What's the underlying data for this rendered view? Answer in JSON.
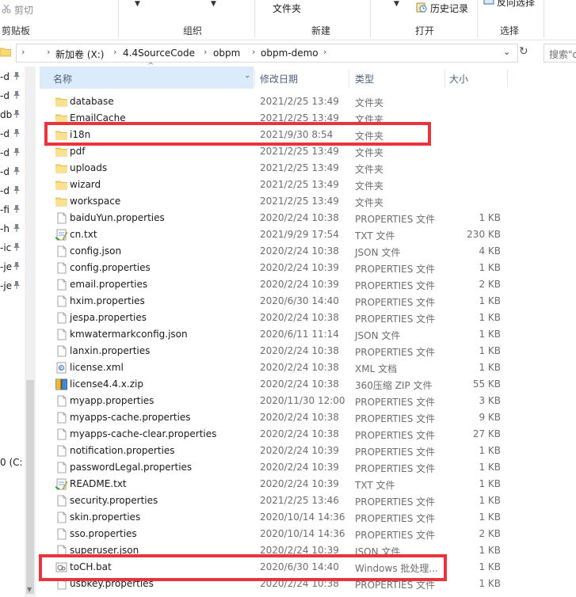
{
  "ribbon": {
    "cut_label": "剪切",
    "clipboard_group": "剪贴板",
    "organize_group": "组织",
    "new_folder_label": "文件夹",
    "new_group": "新建",
    "history_label": "历史记录",
    "open_group": "打开",
    "invert_select_label": "反向选择",
    "select_group": "选择"
  },
  "address": {
    "crumbs": [
      "新加卷 (X:)",
      "4.4SourceCode",
      "obpm",
      "obpm-demo"
    ]
  },
  "search": {
    "placeholder": "搜索\"o"
  },
  "nav": {
    "items": [
      "-d",
      "-d",
      "db",
      "-d",
      "-d",
      "-d",
      "-d",
      "-fi",
      "-h",
      "-ic",
      "-je",
      "-je"
    ],
    "drive_label": "0 (C:"
  },
  "columns": {
    "name": "名称",
    "date": "修改日期",
    "type": "类型",
    "size": "大小"
  },
  "files": [
    {
      "name": "database",
      "date": "2021/2/25 13:49",
      "type": "文件夹",
      "size": "",
      "icon": "folder-icon"
    },
    {
      "name": "EmailCache",
      "date": "2021/2/25 13:49",
      "type": "文件夹",
      "size": "",
      "icon": "folder-icon"
    },
    {
      "name": "i18n",
      "date": "2021/9/30 8:54",
      "type": "文件夹",
      "size": "",
      "icon": "folder-icon"
    },
    {
      "name": "pdf",
      "date": "2021/2/25 13:49",
      "type": "文件夹",
      "size": "",
      "icon": "folder-icon"
    },
    {
      "name": "uploads",
      "date": "2021/2/25 13:49",
      "type": "文件夹",
      "size": "",
      "icon": "folder-icon"
    },
    {
      "name": "wizard",
      "date": "2021/2/25 13:49",
      "type": "文件夹",
      "size": "",
      "icon": "folder-icon"
    },
    {
      "name": "workspace",
      "date": "2021/2/25 13:49",
      "type": "文件夹",
      "size": "",
      "icon": "folder-icon"
    },
    {
      "name": "baiduYun.properties",
      "date": "2020/2/24 10:38",
      "type": "PROPERTIES 文件",
      "size": "1 KB",
      "icon": "file-icon"
    },
    {
      "name": "cn.txt",
      "date": "2021/9/29 17:54",
      "type": "TXT 文件",
      "size": "230 KB",
      "icon": "text-file-icon"
    },
    {
      "name": "config.json",
      "date": "2020/2/24 10:38",
      "type": "JSON 文件",
      "size": "4 KB",
      "icon": "file-icon"
    },
    {
      "name": "config.properties",
      "date": "2020/2/24 10:39",
      "type": "PROPERTIES 文件",
      "size": "1 KB",
      "icon": "file-icon"
    },
    {
      "name": "email.properties",
      "date": "2020/2/24 10:39",
      "type": "PROPERTIES 文件",
      "size": "2 KB",
      "icon": "file-icon"
    },
    {
      "name": "hxim.properties",
      "date": "2020/6/30 14:40",
      "type": "PROPERTIES 文件",
      "size": "1 KB",
      "icon": "file-icon"
    },
    {
      "name": "jespa.properties",
      "date": "2020/2/24 10:38",
      "type": "PROPERTIES 文件",
      "size": "1 KB",
      "icon": "file-icon"
    },
    {
      "name": "kmwatermarkconfig.json",
      "date": "2020/6/11 11:14",
      "type": "JSON 文件",
      "size": "1 KB",
      "icon": "file-icon"
    },
    {
      "name": "lanxin.properties",
      "date": "2020/2/24 10:38",
      "type": "PROPERTIES 文件",
      "size": "1 KB",
      "icon": "file-icon"
    },
    {
      "name": "license.xml",
      "date": "2020/2/24 10:38",
      "type": "XML 文档",
      "size": "1 KB",
      "icon": "xml-file-icon"
    },
    {
      "name": "license4.4.x.zip",
      "date": "2020/2/24 10:38",
      "type": "360压缩 ZIP 文件",
      "size": "55 KB",
      "icon": "zip-file-icon"
    },
    {
      "name": "myapp.properties",
      "date": "2020/11/30 12:00",
      "type": "PROPERTIES 文件",
      "size": "3 KB",
      "icon": "file-icon"
    },
    {
      "name": "myapps-cache.properties",
      "date": "2020/2/24 10:38",
      "type": "PROPERTIES 文件",
      "size": "9 KB",
      "icon": "file-icon"
    },
    {
      "name": "myapps-cache-clear.properties",
      "date": "2020/2/24 10:38",
      "type": "PROPERTIES 文件",
      "size": "27 KB",
      "icon": "file-icon"
    },
    {
      "name": "notification.properties",
      "date": "2020/2/24 10:39",
      "type": "PROPERTIES 文件",
      "size": "1 KB",
      "icon": "file-icon"
    },
    {
      "name": "passwordLegal.properties",
      "date": "2020/2/24 10:39",
      "type": "PROPERTIES 文件",
      "size": "1 KB",
      "icon": "file-icon"
    },
    {
      "name": "README.txt",
      "date": "2020/2/24 10:39",
      "type": "TXT 文件",
      "size": "1 KB",
      "icon": "text-file-icon"
    },
    {
      "name": "security.properties",
      "date": "2021/2/25 13:46",
      "type": "PROPERTIES 文件",
      "size": "1 KB",
      "icon": "file-icon"
    },
    {
      "name": "skin.properties",
      "date": "2020/10/14 14:36",
      "type": "PROPERTIES 文件",
      "size": "1 KB",
      "icon": "file-icon"
    },
    {
      "name": "sso.properties",
      "date": "2020/10/14 14:36",
      "type": "PROPERTIES 文件",
      "size": "2 KB",
      "icon": "file-icon"
    },
    {
      "name": "superuser.json",
      "date": "2020/2/24 10:39",
      "type": "JSON 文件",
      "size": "1 KB",
      "icon": "file-icon"
    },
    {
      "name": "toCH.bat",
      "date": "2020/6/30 14:40",
      "type": "Windows 批处理...",
      "size": "1 KB",
      "icon": "bat-file-icon"
    },
    {
      "name": "usbkey.properties",
      "date": "2020/2/24 10:38",
      "type": "PROPERTIES 文件",
      "size": "1 KB",
      "icon": "file-icon"
    }
  ]
}
